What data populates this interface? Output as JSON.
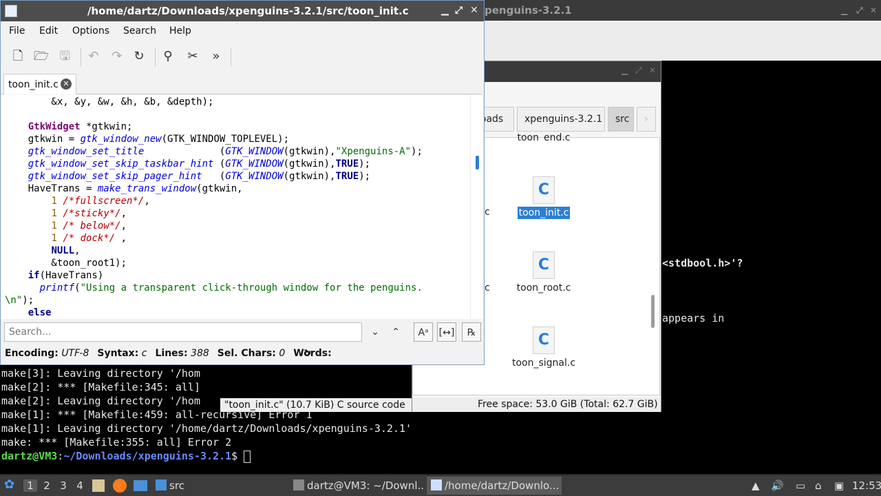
{
  "background_window": {
    "title": "penguins-3.2.1"
  },
  "terminal": {
    "lines": [
      "make[3]: Leaving directory '/hom",
      "make[2]: *** [Makefile:345: all]",
      "make[2]: Leaving directory '/hom",
      "make[1]: *** [Makefile:459: all-recursive] Error 1",
      "make[1]: Leaving directory '/home/dartz/Downloads/xpenguins-3.2.1'",
      "make: *** [Makefile:355: all] Error 2"
    ],
    "right_lines": [
      "<stdbool.h>'?",
      "appears in"
    ],
    "prompt_user": "dartz@VM3",
    "prompt_sep": ":",
    "prompt_path": "~/Downloads/xpenguins-3.2.1",
    "prompt_end": "$ "
  },
  "file_manager": {
    "breadcrumbs": [
      "loads",
      "xpenguins-3.2.1",
      "src"
    ],
    "files": [
      {
        "name": "toon_end.c"
      },
      {
        "name": "toon_init.c",
        "selected": true
      },
      {
        "name": "toon_root.c"
      },
      {
        "name": "toon_signal.c"
      }
    ],
    "partial_labels": [
      "c",
      "c"
    ],
    "file_icon_letter": "C",
    "status_left": "\"toon_init.c\" (10.7 KiB) C source code",
    "status_right": "Free space: 53.0 GiB (Total: 62.7 GiB)"
  },
  "editor": {
    "title": "/home/dartz/Downloads/xpenguins-3.2.1/src/toon_init.c",
    "menu": [
      "File",
      "Edit",
      "Options",
      "Search",
      "Help"
    ],
    "tab_label": "toon_init.c",
    "code": {
      "l1": "        &x, &y, &w, &h, &b, &depth);",
      "l3_type": "GtkWidget",
      "l3_rest": " *gtkwin;",
      "l4_a": "    gtkwin = ",
      "l4_fn": "gtk_window_new",
      "l4_b": "(GTK_WINDOW_TOPLEVEL);",
      "l5_fn": "gtk_window_set_title",
      "l5_pad": "             (",
      "l5_fn2": "GTK_WINDOW",
      "l5_b": "(gtkwin),",
      "l5_str": "\"Xpenguins-A\"",
      "l5_c": ");",
      "l6_fn": "gtk_window_set_skip_taskbar_hint",
      "l6_pad": " (",
      "l6_b": "(gtkwin),",
      "l6_kw": "TRUE",
      "l6_c": ");",
      "l7_fn": "gtk_window_set_skip_pager_hint",
      "l7_pad": "   (",
      "l8_a": "    HaveTrans = ",
      "l8_fn": "make_trans_window",
      "l8_b": "(gtkwin,",
      "l9_cm": "/*fullscreen*/",
      "l10_cm": "/*sticky*/",
      "l11_cm": "/* below*/",
      "l12_cm": "/* dock*/",
      "num1": "1",
      "l13_kw": "NULL",
      "l14": "        &toon_root1);",
      "l15_kw": "if",
      "l15_b": "(HaveTrans)",
      "l16_fn": "printf",
      "l16_str": "\"Using a transparent click-through window for the penguins.",
      "l17_str": "\\n\"",
      "l17_b": ");",
      "l18_kw": "else"
    },
    "search_placeholder": "Search...",
    "status": {
      "encoding_label": "Encoding:",
      "encoding": "UTF-8",
      "syntax_label": "Syntax:",
      "syntax": "c",
      "lines_label": "Lines:",
      "lines": "388",
      "sel_label": "Sel. Chars:",
      "sel": "0",
      "words_label": "Words:"
    }
  },
  "taskbar": {
    "workspaces": [
      "1",
      "2",
      "3",
      "4"
    ],
    "folder_label": "src",
    "task1": "dartz@VM3: ~/Downl...",
    "task2": "/home/dartz/Downlo...",
    "clock": "12:53"
  }
}
